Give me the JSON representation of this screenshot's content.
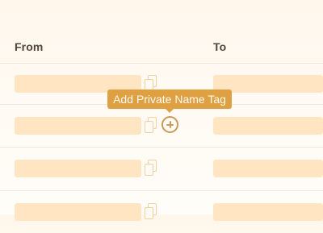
{
  "table": {
    "columns": {
      "from": "From",
      "to": "To"
    },
    "rows": [
      {
        "has_add_button": false
      },
      {
        "has_add_button": true
      },
      {
        "has_add_button": false
      },
      {
        "has_add_button": false
      }
    ]
  },
  "tooltip": {
    "text": "Add Private Name Tag"
  },
  "icons": {
    "copy": "copy-icon",
    "add": "plus-circle-icon"
  },
  "colors": {
    "accent": "#dfa042",
    "placeholder": "#ffe4bf",
    "icon": "#c99a59"
  }
}
